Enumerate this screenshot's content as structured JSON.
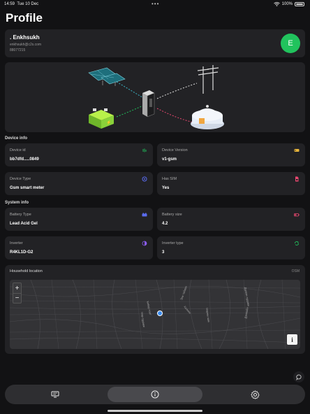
{
  "status_bar": {
    "time": "14:59",
    "date": "Tue 10 Dec",
    "battery": "100%"
  },
  "page": {
    "title": "Profile"
  },
  "profile": {
    "name": ". Enkhsukh",
    "email": "enkhsukh@c2s.com",
    "phone": "88077215",
    "avatar_letter": "E",
    "avatar_color": "#21c35d"
  },
  "device_info": {
    "heading": "Device info",
    "items": [
      {
        "label": "Device id",
        "value": "bb7dfd.....0849",
        "icon": "fingerprint-icon",
        "icon_color": "#21c35d"
      },
      {
        "label": "Device Version",
        "value": "v1-gsm",
        "icon": "tag-icon",
        "icon_color": "#e7b53c"
      },
      {
        "label": "Device Type",
        "value": "Gsm smart meter",
        "icon": "gauge-icon",
        "icon_color": "#5a6cf0"
      },
      {
        "label": "Has SIM",
        "value": "Yes",
        "icon": "sim-card-icon",
        "icon_color": "#e8476f"
      }
    ]
  },
  "system_info": {
    "heading": "System info",
    "items": [
      {
        "label": "Battery Type",
        "value": "Lead Acid Gel",
        "icon": "battery-icon",
        "icon_color": "#5a6cf0"
      },
      {
        "label": "Battery size",
        "value": "4.2",
        "icon": "battery-low-icon",
        "icon_color": "#e8476f"
      },
      {
        "label": "Inverter",
        "value": "R4KL1D-G2",
        "icon": "half-circle-icon",
        "icon_color": "#8b5cf6"
      },
      {
        "label": "Inverter type",
        "value": "3",
        "icon": "cycle-icon",
        "icon_color": "#21c35d"
      }
    ]
  },
  "map": {
    "title": "Household location",
    "attribution": "OSM",
    "zoom_in": "+",
    "zoom_out": "−",
    "info": "i",
    "streets": [
      "Кибер тоот",
      "Нар гудамж",
      "Энх тайван",
      "Хилчин",
      "Нарны зам",
      "Дурвэн гудамж",
      "Дэнжийн"
    ]
  },
  "tabs": [
    {
      "name": "dashboard",
      "icon": "monitor-icon",
      "active": false
    },
    {
      "name": "info",
      "icon": "info-icon",
      "active": true
    },
    {
      "name": "settings",
      "icon": "gear-icon",
      "active": false
    }
  ]
}
